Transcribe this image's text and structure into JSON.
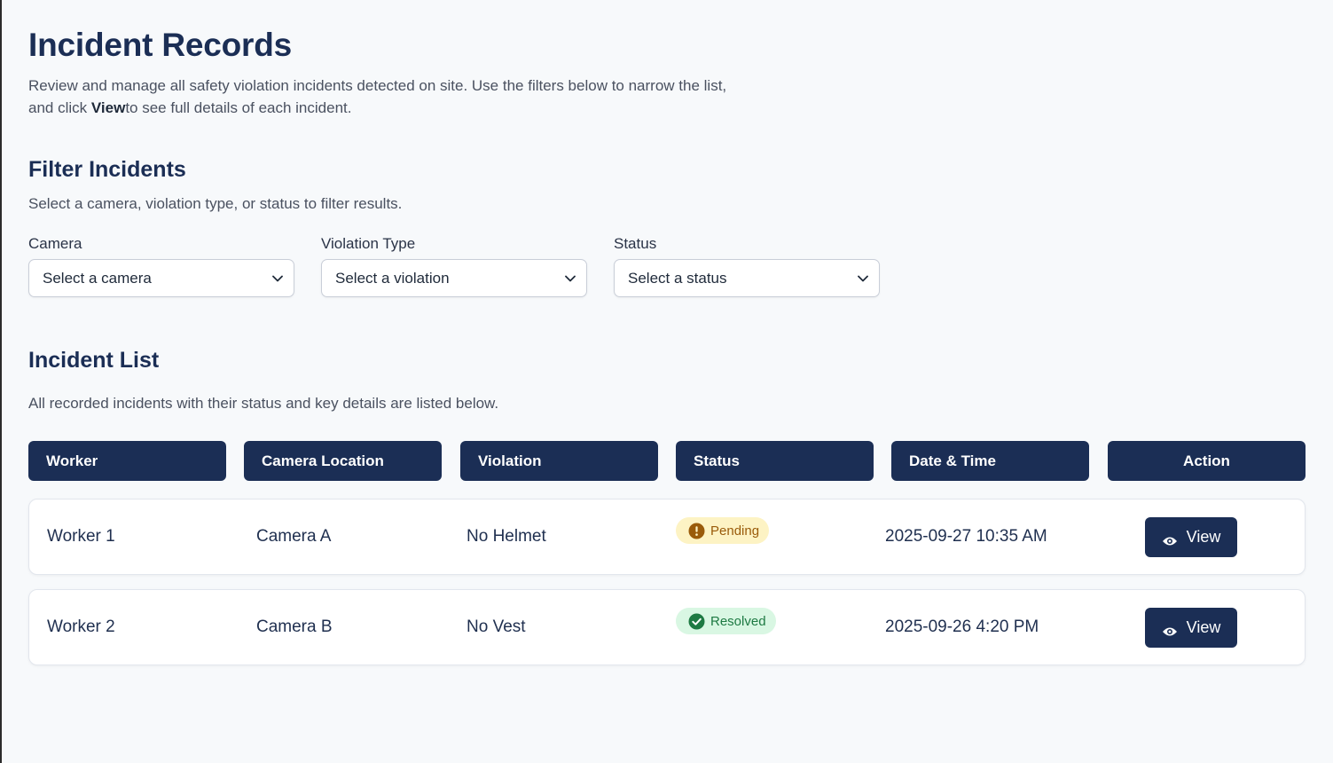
{
  "header": {
    "title": "Incident Records",
    "intro_line1": "Review and manage all safety violation incidents detected on site. Use the filters below to narrow the list,",
    "intro_pre": "and click ",
    "intro_bold": "View",
    "intro_post": "to see full details of each incident."
  },
  "filters": {
    "title": "Filter Incidents",
    "subtitle": "Select a camera, violation type, or status to filter results.",
    "camera": {
      "label": "Camera",
      "value": "Select a camera"
    },
    "violation": {
      "label": "Violation Type",
      "value": "Select a violation"
    },
    "status": {
      "label": "Status",
      "value": "Select a status"
    }
  },
  "list": {
    "title": "Incident List",
    "subtitle": "All recorded incidents with their status and key details are listed below.",
    "columns": [
      "Worker",
      "Camera Location",
      "Violation",
      "Status",
      "Date & Time",
      "Action"
    ],
    "rows": [
      {
        "worker": "Worker 1",
        "camera": "Camera A",
        "violation": "No Helmet",
        "status": "Pending",
        "status_icon": "exclamation-icon",
        "datetime": "2025-09-27 10:35 AM",
        "action": "View"
      },
      {
        "worker": "Worker 2",
        "camera": "Camera B",
        "violation": "No Vest",
        "status": "Resolved",
        "status_icon": "check-icon",
        "datetime": "2025-09-26 4:20 PM",
        "action": "View"
      }
    ]
  },
  "colors": {
    "primary": "#1b2e55",
    "pending_bg": "#fdf3c4",
    "pending_text": "#9a5b0a",
    "resolved_bg": "#d9f7e3",
    "resolved_text": "#1e7a43"
  }
}
